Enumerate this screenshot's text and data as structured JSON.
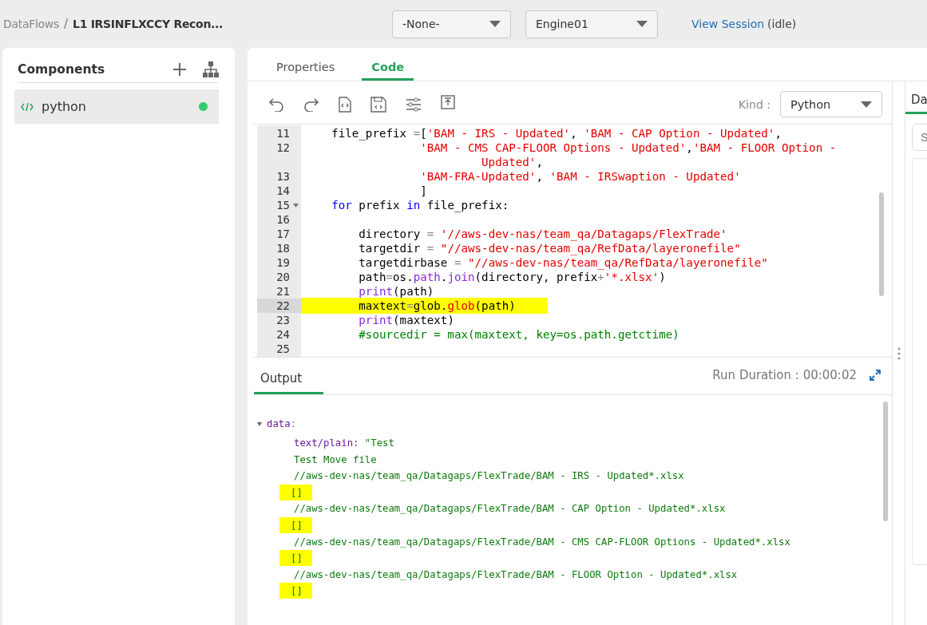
{
  "breadcrumb": {
    "items": [
      "DataFlows",
      "L1 IRSINFLXCCY Recon..."
    ],
    "separator": "/"
  },
  "selects": [
    {
      "value": "-None-"
    },
    {
      "value": "Engine01"
    }
  ],
  "session": {
    "link": "View Session",
    "status": "(idle)"
  },
  "components": {
    "title": "Components",
    "items": [
      {
        "label": "python",
        "selected": true,
        "color": "#2ecc71"
      }
    ]
  },
  "editor_tabs": [
    {
      "label": "Properties",
      "selected": false
    },
    {
      "label": "Code",
      "selected": true
    }
  ],
  "toolbar": {
    "kind_label": "Kind :",
    "kind_value": "Python"
  },
  "code": {
    "lines": [
      {
        "number": "11",
        "segments": [
          {
            "kind": "plain",
            "text": "    file_prefix "
          },
          {
            "kind": "operator",
            "text": "="
          },
          {
            "kind": "plain",
            "text": "["
          },
          {
            "kind": "string",
            "text": "'BAM - IRS - Updated'"
          },
          {
            "kind": "plain",
            "text": ", "
          },
          {
            "kind": "string",
            "text": "'BAM - CAP Option - Updated'"
          },
          {
            "kind": "plain",
            "text": ","
          }
        ]
      },
      {
        "number": "12",
        "segments": [
          {
            "kind": "string",
            "text": "                 'BAM - CMS CAP-FLOOR Options - Updated'"
          },
          {
            "kind": "plain",
            "text": ","
          },
          {
            "kind": "string",
            "text": "'BAM - FLOOR Option -"
          }
        ],
        "continuation": [
          {
            "kind": "string",
            "text": "Updated'"
          },
          {
            "kind": "plain",
            "text": ","
          }
        ]
      },
      {
        "number": "13",
        "segments": [
          {
            "kind": "string",
            "text": "                 'BAM-FRA-Updated'"
          },
          {
            "kind": "plain",
            "text": ", "
          },
          {
            "kind": "string",
            "text": "'BAM - IRSwaption - Updated'"
          }
        ]
      },
      {
        "number": "14",
        "segments": [
          {
            "kind": "plain",
            "text": "                 ]"
          }
        ]
      },
      {
        "number": "15",
        "foldable": true,
        "segments": [
          {
            "kind": "keyword",
            "text": "    for"
          },
          {
            "kind": "plain",
            "text": " prefix "
          },
          {
            "kind": "keyword",
            "text": "in"
          },
          {
            "kind": "plain",
            "text": " file_prefix:"
          }
        ]
      },
      {
        "number": "16"
      },
      {
        "number": "17",
        "segments": [
          {
            "kind": "plain",
            "text": "        directory "
          },
          {
            "kind": "operator",
            "text": "="
          },
          {
            "kind": "string",
            "text": " '//aws-dev-nas/team_qa/Datagaps/FlexTrade'"
          }
        ]
      },
      {
        "number": "18",
        "segments": [
          {
            "kind": "plain",
            "text": "        targetdir "
          },
          {
            "kind": "operator",
            "text": "="
          },
          {
            "kind": "string",
            "text": " \"//aws-dev-nas/team_qa/RefData/layeronefile\""
          }
        ]
      },
      {
        "number": "19",
        "segments": [
          {
            "kind": "plain",
            "text": "        targetdirbase "
          },
          {
            "kind": "operator",
            "text": "="
          },
          {
            "kind": "string",
            "text": " \"//aws-dev-nas/team_qa/RefData/layeronefile\""
          }
        ]
      },
      {
        "number": "20",
        "segments": [
          {
            "kind": "plain",
            "text": "        path"
          },
          {
            "kind": "operator",
            "text": "="
          },
          {
            "kind": "plain",
            "text": "os."
          },
          {
            "kind": "builtin",
            "text": "path"
          },
          {
            "kind": "plain",
            "text": "."
          },
          {
            "kind": "builtin",
            "text": "join"
          },
          {
            "kind": "plain",
            "text": "(directory, prefix"
          },
          {
            "kind": "operator",
            "text": "+"
          },
          {
            "kind": "string",
            "text": "'*.xlsx'"
          },
          {
            "kind": "plain",
            "text": ")"
          }
        ]
      },
      {
        "number": "21",
        "segments": [
          {
            "kind": "builtin",
            "text": "        print"
          },
          {
            "kind": "plain",
            "text": "(path)"
          }
        ]
      },
      {
        "number": "22",
        "active": true,
        "highlighted": true,
        "segments": [
          {
            "kind": "plain",
            "text": "        maxtext"
          },
          {
            "kind": "operator",
            "text": "="
          },
          {
            "kind": "plain",
            "text": "glob."
          },
          {
            "kind": "string",
            "text": "glob"
          },
          {
            "kind": "plain",
            "text": "(path)"
          }
        ]
      },
      {
        "number": "23",
        "segments": [
          {
            "kind": "builtin",
            "text": "        print"
          },
          {
            "kind": "plain",
            "text": "(maxtext)"
          }
        ]
      },
      {
        "number": "24",
        "segments": [
          {
            "kind": "comment",
            "text": "        #sourcedir = max(maxtext, key=os.path.getctime)"
          }
        ]
      },
      {
        "number": "25"
      }
    ]
  },
  "output": {
    "tab": "Output",
    "run_duration": "Run Duration : 00:00:02",
    "tree_key": "data",
    "tree_colon": ":",
    "expanded": true,
    "lines": [
      {
        "segments": [
          {
            "kind": "key",
            "text": "text/plain:"
          },
          {
            "kind": "value",
            "text": " \"Test"
          }
        ]
      },
      {
        "segments": [
          {
            "kind": "value",
            "text": "Test Move file"
          }
        ]
      },
      {
        "segments": [
          {
            "kind": "value",
            "text": "//aws-dev-nas/team_qa/Datagaps/FlexTrade/BAM - IRS - Updated*.xlsx"
          }
        ]
      },
      {
        "highlighted": true,
        "segments": [
          {
            "kind": "value",
            "text": "[]"
          }
        ]
      },
      {
        "segments": [
          {
            "kind": "value",
            "text": "//aws-dev-nas/team_qa/Datagaps/FlexTrade/BAM - CAP Option - Updated*.xlsx"
          }
        ]
      },
      {
        "highlighted": true,
        "segments": [
          {
            "kind": "value",
            "text": "[]"
          }
        ]
      },
      {
        "segments": [
          {
            "kind": "value",
            "text": "//aws-dev-nas/team_qa/Datagaps/FlexTrade/BAM - CMS CAP-FLOOR Options - Updated*.xlsx"
          }
        ]
      },
      {
        "highlighted": true,
        "segments": [
          {
            "kind": "value",
            "text": "[]"
          }
        ]
      },
      {
        "segments": [
          {
            "kind": "value",
            "text": "//aws-dev-nas/team_qa/Datagaps/FlexTrade/BAM - FLOOR Option - Updated*.xlsx"
          }
        ]
      },
      {
        "highlighted": true,
        "segments": [
          {
            "kind": "value",
            "text": "[]"
          }
        ]
      }
    ]
  },
  "right_panel": {
    "tab": "Da",
    "search_placeholder": "S"
  }
}
